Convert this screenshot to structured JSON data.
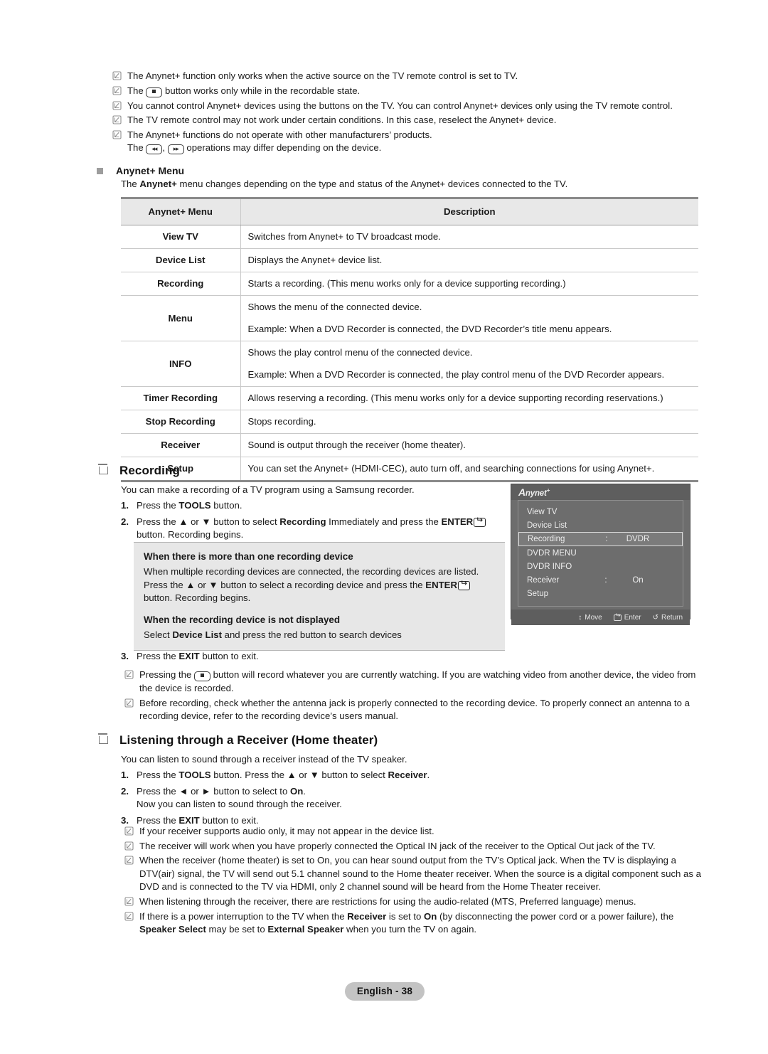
{
  "top_notes": [
    {
      "html": "The Anynet+ function only works when the active source on the TV remote control is set to TV."
    },
    {
      "html": "The <KEY_REC> button works only while in the recordable state."
    },
    {
      "html": "You cannot control Anynet+ devices using the buttons on the TV. You can control Anynet+ devices only using the TV remote control."
    },
    {
      "html": "The TV remote control may not work under certain conditions. In this case, reselect the Anynet+ device."
    },
    {
      "html": "The Anynet+ functions do not operate with other manufacturers’ products.<br>The <KEY_RW>, <KEY_FF> operations may differ depending on the device."
    }
  ],
  "anynet_menu_section": {
    "heading": "Anynet+ Menu",
    "intro_html": "The <b>Anynet+</b> menu changes depending on the type and status of the Anynet+ devices connected to the TV."
  },
  "table": {
    "headers": [
      "Anynet+ Menu",
      "Description"
    ],
    "rows": [
      {
        "menu": "View TV",
        "desc": [
          "Switches from Anynet+ to TV broadcast mode."
        ]
      },
      {
        "menu": "Device List",
        "desc": [
          "Displays the Anynet+ device list."
        ]
      },
      {
        "menu": "Recording",
        "desc": [
          "Starts a recording. (This menu works only for a device supporting recording.)"
        ]
      },
      {
        "menu": "Menu",
        "desc": [
          "Shows the menu of the connected device.",
          "Example: When a DVD Recorder is connected, the DVD Recorder’s title menu appears."
        ]
      },
      {
        "menu": "INFO",
        "desc": [
          "Shows the play control menu of the connected device.",
          "Example: When a DVD Recorder is connected, the play control menu of the DVD Recorder appears."
        ]
      },
      {
        "menu": "Timer Recording",
        "desc": [
          "Allows reserving a recording. (This menu works only for a device supporting recording reservations.)"
        ]
      },
      {
        "menu": "Stop Recording",
        "desc": [
          "Stops recording."
        ]
      },
      {
        "menu": "Receiver",
        "desc": [
          "Sound is output through the receiver (home theater)."
        ]
      },
      {
        "menu": "Setup",
        "desc": [
          "You can set the Anynet+ (HDMI-CEC), auto turn off, and searching connections for using Anynet+."
        ]
      }
    ]
  },
  "recording_section": {
    "heading": "Recording",
    "intro": "You can make a recording of a TV program using a Samsung recorder.",
    "steps": [
      {
        "num": "1.",
        "html": "Press the <b>TOOLS</b> button."
      },
      {
        "num": "2.",
        "html": "Press the ▲ or ▼ button to select <b>Recording</b> Immediately and press the <b>ENTER</b><ENTERKEY><br>button. Recording begins."
      },
      {
        "num": "3.",
        "html": "Press the <b>EXIT</b> button to exit."
      }
    ],
    "infobox": {
      "head1": "When there is more than one recording device",
      "body1": "When multiple recording devices are connected, the recording devices are listed. Press the ▲ or ▼ button to select a recording device and press the <b>ENTER</b><ENTERKEY> button. Recording begins.",
      "head2": "When the recording device is not displayed",
      "body2": "Select <b>Device List</b> and press the red button to search devices"
    },
    "notes": [
      {
        "html": "Pressing the <KEY_REC> button will record whatever you are currently watching. If you are watching video from another device, the video from the device is recorded."
      },
      {
        "html": "Before recording, check whether the antenna jack is properly connected to the recording device. To properly connect an antenna to a recording device, refer to the recording device’s users manual."
      }
    ]
  },
  "osd": {
    "logo": "Anynet",
    "logo_plus": "+",
    "items": [
      {
        "label": "View TV",
        "value": "",
        "selected": false,
        "has_value": false
      },
      {
        "label": "Device List",
        "value": "",
        "selected": false,
        "has_value": false
      },
      {
        "label": "Recording",
        "value": "DVDR",
        "selected": true,
        "has_value": true
      },
      {
        "label": "DVDR MENU",
        "value": "",
        "selected": false,
        "has_value": false
      },
      {
        "label": "DVDR INFO",
        "value": "",
        "selected": false,
        "has_value": false
      },
      {
        "label": "Receiver",
        "value": "On",
        "selected": false,
        "has_value": true
      },
      {
        "label": "Setup",
        "value": "",
        "selected": false,
        "has_value": false
      }
    ],
    "colon": ":",
    "footer": [
      {
        "icon": "move-updown-icon",
        "glyph": "↕",
        "label": "Move"
      },
      {
        "icon": "enter-icon",
        "glyph": "",
        "label": "Enter"
      },
      {
        "icon": "return-icon",
        "glyph": "↺",
        "label": "Return"
      }
    ]
  },
  "receiver_section": {
    "heading": "Listening through a Receiver (Home theater)",
    "intro": "You can listen to sound through a receiver instead of the TV speaker.",
    "steps": [
      {
        "num": "1.",
        "html": "Press the <b>TOOLS</b> button. Press the ▲ or ▼ button to select <b>Receiver</b>."
      },
      {
        "num": "2.",
        "html": "Press the ◄ or ► button to select to <b>On</b>.<br>Now you can listen to sound through the receiver."
      },
      {
        "num": "3.",
        "html": "Press the <b>EXIT</b> button to exit."
      }
    ],
    "notes": [
      {
        "html": "If your receiver supports audio only, it may not appear in the device list."
      },
      {
        "html": "The receiver will work when you have properly connected the Optical IN jack of the receiver to the Optical Out jack of the TV."
      },
      {
        "html": "When the receiver (home theater) is set to On, you can hear sound output from the TV’s Optical jack. When the TV is displaying a DTV(air) signal, the TV will send out 5.1 channel sound to the Home theater receiver. When the source is a digital component such as a DVD and is connected to the TV via HDMI, only 2 channel sound will be heard from the Home Theater receiver."
      },
      {
        "html": "When listening through the receiver, there are restrictions for using the audio-related (MTS, Preferred language) menus."
      },
      {
        "html": "If there is a power interruption to the TV when the <b>Receiver</b> is set to <b>On</b> (by disconnecting the power cord or a power failure), the <b>Speaker Select</b> may be set to <b>External Speaker</b> when you turn the TV on again."
      }
    ]
  },
  "footer": {
    "page_label": "English - 38"
  },
  "colors": {
    "table_header_bg": "#e8e8e8",
    "infobox_bg": "#e7e7e7",
    "osd_bg": "#6d6d6d",
    "page_badge_bg": "#c3c3c3",
    "rule": "#8a8a8a"
  }
}
